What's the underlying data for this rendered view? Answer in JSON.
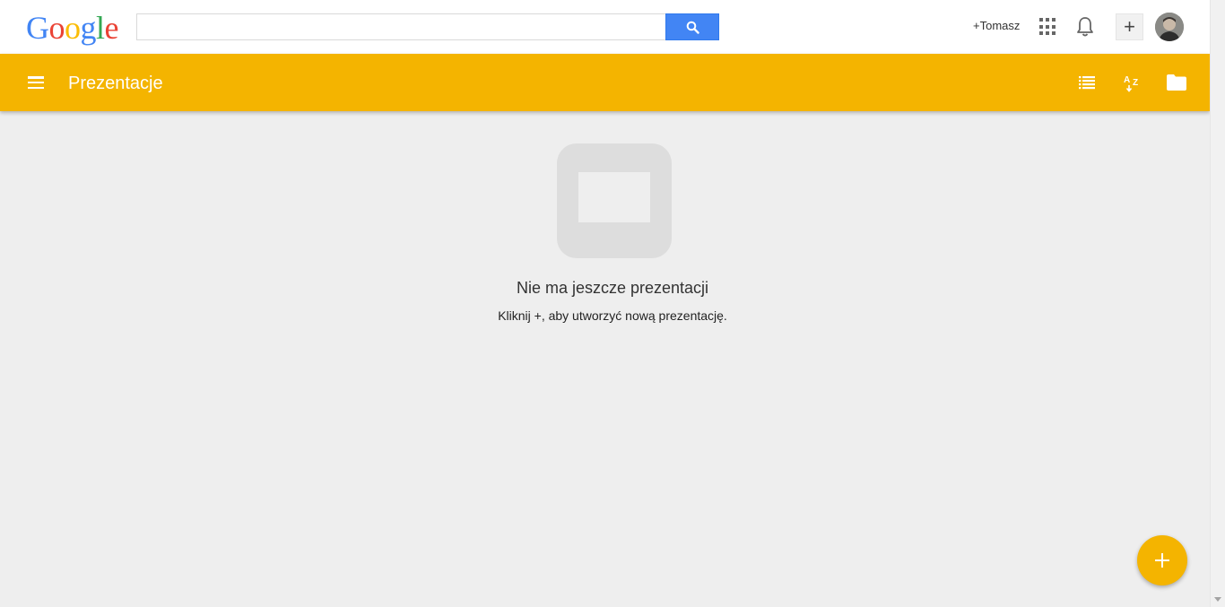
{
  "gbar": {
    "logo": [
      "G",
      "o",
      "o",
      "g",
      "l",
      "e"
    ],
    "search": {
      "value": "",
      "placeholder": ""
    },
    "user_link": "+Tomasz",
    "apps_icon": "apps-grid-icon",
    "notifications_icon": "bell-icon",
    "share_label": "+"
  },
  "toolbar": {
    "menu_icon": "hamburger-menu-icon",
    "title": "Prezentacje",
    "actions": [
      "list-view-icon",
      "sort-az-icon",
      "folder-icon"
    ],
    "color": "#f4b400"
  },
  "empty_state": {
    "title": "Nie ma jeszcze prezentacji",
    "subtitle": "Kliknij +, aby utworzyć nową prezentację."
  },
  "fab": {
    "icon": "plus-icon",
    "color": "#f4b400"
  },
  "colors": {
    "accent": "#f4b400",
    "search_button": "#4285f4",
    "background": "#eeeeee"
  }
}
